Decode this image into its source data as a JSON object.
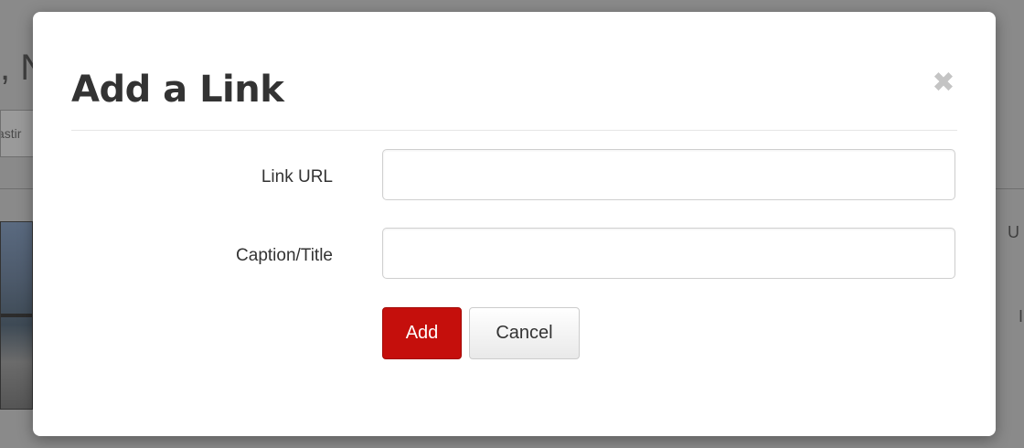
{
  "background": {
    "header_fragment": ", N",
    "tab_fragment": "astir",
    "side_fragment_1": "U",
    "side_fragment_2": "I"
  },
  "modal": {
    "title": "Add a Link",
    "close_icon": "close-icon",
    "close_glyph": "✖",
    "fields": {
      "url_label": "Link URL",
      "url_value": "",
      "caption_label": "Caption/Title",
      "caption_value": ""
    },
    "buttons": {
      "add_label": "Add",
      "cancel_label": "Cancel"
    },
    "colors": {
      "primary": "#c50f0c",
      "overlay": "#7b7b7b"
    }
  }
}
